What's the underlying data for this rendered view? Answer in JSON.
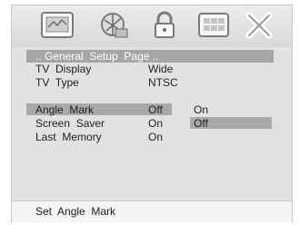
{
  "toolbar": {
    "icons": [
      "system-setup-icon",
      "audio-setup-icon",
      "lock-icon",
      "video-setup-icon",
      "exit-icon"
    ]
  },
  "title": ".. General  Setup  Page ..",
  "menu": [
    {
      "label": "TV  Display",
      "value": "Wide"
    },
    {
      "label": "TV  Type",
      "value": "NTSC"
    },
    {
      "label": "Angle  Mark",
      "value": "Off"
    },
    {
      "label": "Screen  Saver",
      "value": "On"
    },
    {
      "label": "Last  Memory",
      "value": "On"
    }
  ],
  "options": [
    "On",
    "Off"
  ],
  "status": "Set  Angle  Mark",
  "colors": {
    "highlight": "#a9a9a9",
    "background": "#e2e2e2"
  }
}
